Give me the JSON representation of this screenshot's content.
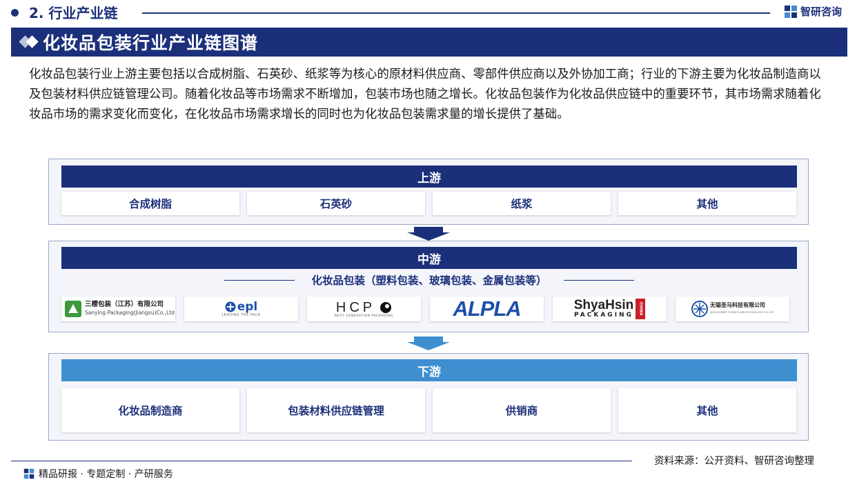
{
  "header": {
    "section": "2. 行业产业链",
    "brand": "智研咨询",
    "title": "化妆品包装行业产业链图谱"
  },
  "intro": "化妆品包装行业上游主要包括以合成树脂、石英砂、纸浆等为核心的原材料供应商、零部件供应商以及外协加工商；行业的下游主要为化妆品制造商以及包装材料供应链管理公司。随着化妆品等市场需求不断增加，包装市场也随之增长。化妆品包装作为化妆品供应链中的重要环节，其市场需求随着化妆品市场的需求变化而变化，在化妆品市场需求增长的同时也为化妆品包装需求量的增长提供了基础。",
  "upstream": {
    "title": "上游",
    "items": [
      "合成树脂",
      "石英砂",
      "纸浆",
      "其他"
    ]
  },
  "midstream": {
    "title": "中游",
    "subtitle": "化妆品包装（塑料包装、玻璃包装、金属包装等）",
    "logos": {
      "sanying_cn": "三樱包装（江苏）有限公司",
      "sanying_en": "Sanying Packaging(Jiangsu)Co.,Ltd",
      "epl": "epl",
      "epl_tag": "LEADING THE PACK",
      "hcp": "HCP",
      "hcp_tag": "NEXT GENERATION PACKAGING",
      "alpla": "ALPLA",
      "shyahsin_main": "ShyaHsin",
      "shyahsin_sub": "PACKAGING",
      "shyahsin_side": "CHINA",
      "shengma_cn": "无锡圣马科技有限公司",
      "shengma_en": "WUXI SUMMIT SCIENCE AND TECHNOLOGY CO.,LTD"
    }
  },
  "downstream": {
    "title": "下游",
    "items": [
      "化妆品制造商",
      "包装材料供应链管理",
      "供销商",
      "其他"
    ]
  },
  "footer": {
    "left": "精品研报 · 专题定制 · 产研服务",
    "source": "资料来源：公开资料、智研咨询整理"
  },
  "colors": {
    "navy": "#1b2f7a",
    "light_blue": "#3f8fd0",
    "alpla_blue": "#1d4fa8",
    "shyahsin_red": "#c8202a",
    "sanying_green": "#3c9a3c"
  }
}
